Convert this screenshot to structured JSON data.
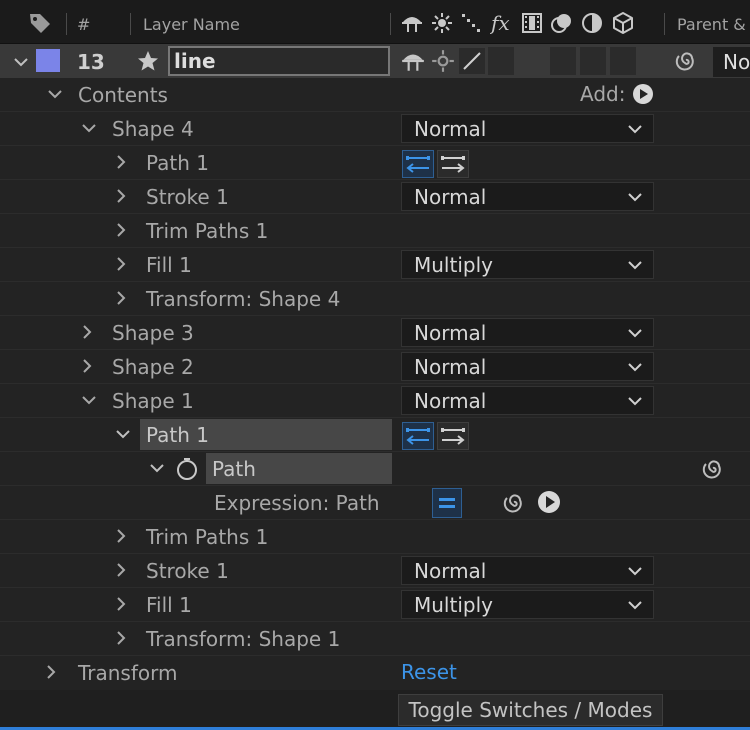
{
  "header": {
    "hash": "#",
    "layer_name": "Layer Name",
    "parent": "Parent &",
    "switch_icons": [
      "shy-icon",
      "collapse-icon",
      "quality-icon",
      "fx-icon",
      "frame-blend-icon",
      "motion-blur-icon",
      "adjustment-layer-icon",
      "3d-layer-icon"
    ]
  },
  "layer": {
    "number": "13",
    "name": "line",
    "label_color": "#7b84e8",
    "parent_value": "No"
  },
  "contents": {
    "label": "Contents",
    "add_label": "Add:"
  },
  "shapes": {
    "shape4": {
      "label": "Shape 4",
      "mode": "Normal",
      "path": "Path 1",
      "stroke": "Stroke 1",
      "stroke_mode": "Normal",
      "trim": "Trim Paths 1",
      "fill": "Fill 1",
      "fill_mode": "Multiply",
      "transform": "Transform: Shape 4"
    },
    "shape3": {
      "label": "Shape 3",
      "mode": "Normal"
    },
    "shape2": {
      "label": "Shape 2",
      "mode": "Normal"
    },
    "shape1": {
      "label": "Shape 1",
      "mode": "Normal",
      "path": "Path 1",
      "path_prop": "Path",
      "expression": "Expression: Path",
      "trim": "Trim Paths 1",
      "stroke": "Stroke 1",
      "stroke_mode": "Normal",
      "fill": "Fill 1",
      "fill_mode": "Multiply",
      "transform": "Transform: Shape 1"
    }
  },
  "transform": {
    "label": "Transform",
    "reset": "Reset"
  },
  "footer": {
    "toggle": "Toggle Switches / Modes"
  },
  "colors": {
    "accent_blue": "#3c94e8",
    "label_chip": "#7b84e8",
    "panel_bg": "#232323"
  }
}
